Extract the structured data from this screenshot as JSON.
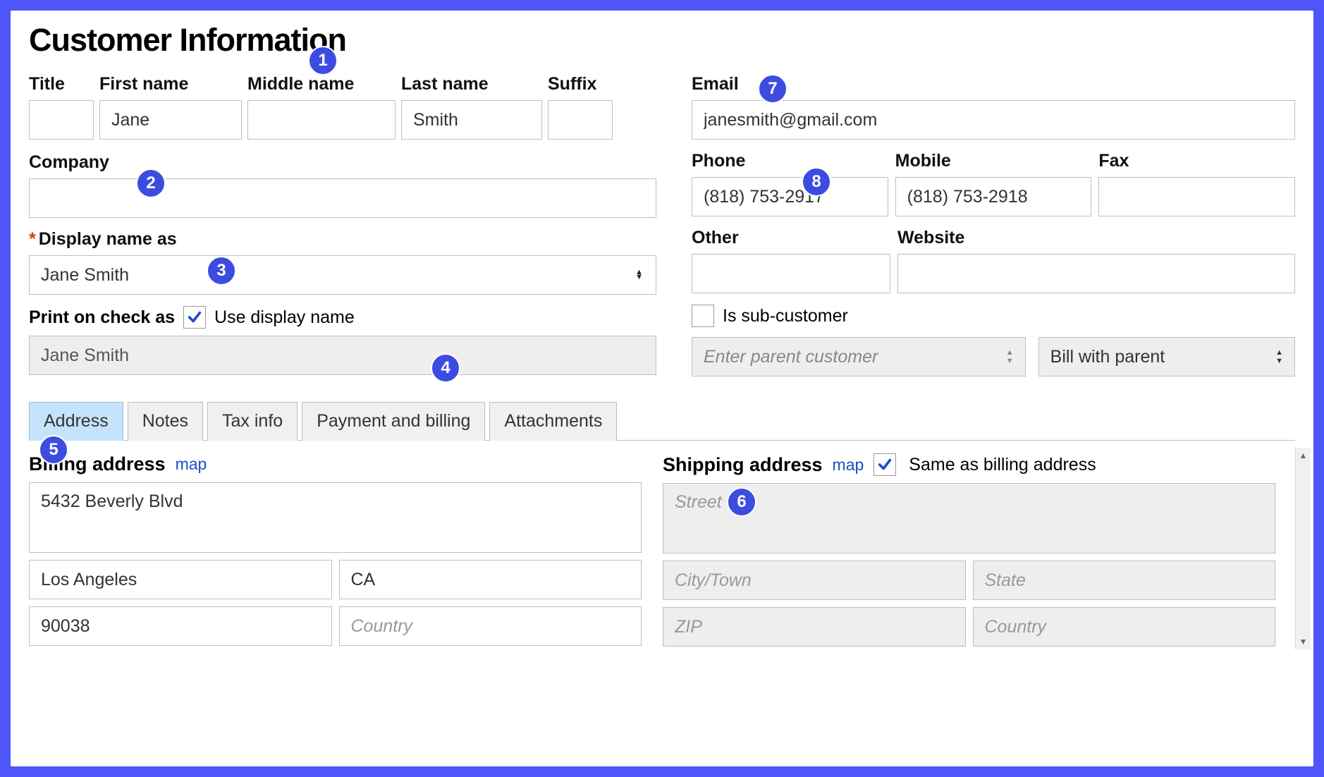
{
  "title": "Customer Information",
  "labels": {
    "title_f": "Title",
    "first": "First name",
    "middle": "Middle name",
    "last": "Last name",
    "suffix": "Suffix",
    "company": "Company",
    "display_as": "Display name as",
    "print_check": "Print on check as",
    "use_display": "Use display name",
    "email": "Email",
    "phone": "Phone",
    "mobile": "Mobile",
    "fax": "Fax",
    "other": "Other",
    "website": "Website",
    "sub_customer": "Is sub-customer",
    "parent_placeholder": "Enter parent customer",
    "bill_parent": "Bill with parent",
    "billing_addr": "Billing address",
    "shipping_addr": "Shipping address",
    "map": "map",
    "same_as_billing": "Same as billing address"
  },
  "name": {
    "title": "",
    "first": "Jane",
    "middle": "",
    "last": "Smith",
    "suffix": ""
  },
  "company": "",
  "display_name": "Jane Smith",
  "print_on_check": "Jane Smith",
  "use_display_name_checked": true,
  "email": "janesmith@gmail.com",
  "phone": "(818) 753-2917",
  "mobile": "(818) 753-2918",
  "fax": "",
  "other": "",
  "website": "",
  "is_sub_customer": false,
  "tabs": [
    "Address",
    "Notes",
    "Tax info",
    "Payment and billing",
    "Attachments"
  ],
  "active_tab": 0,
  "billing": {
    "street": "5432 Beverly Blvd",
    "city": "Los Angeles",
    "state": "CA",
    "zip": "90038",
    "country": ""
  },
  "shipping_same_as_billing": true,
  "placeholders": {
    "street": "Street",
    "city": "City/Town",
    "state": "State",
    "zip": "ZIP",
    "country": "Country"
  },
  "annotations": [
    "1",
    "2",
    "3",
    "4",
    "5",
    "6",
    "7",
    "8"
  ]
}
